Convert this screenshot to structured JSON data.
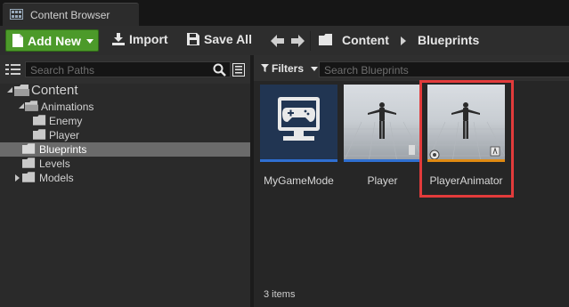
{
  "tab": {
    "title": "Content Browser",
    "icon": "content-browser-icon"
  },
  "toolbar": {
    "add_new_label": "Add New",
    "import_label": "Import",
    "save_all_label": "Save All",
    "breadcrumb": [
      "Content",
      "Blueprints"
    ]
  },
  "left": {
    "search_placeholder": "Search Paths",
    "tree": [
      {
        "label": "Content",
        "expander": "open"
      },
      {
        "label": "Animations",
        "expander": "open"
      },
      {
        "label": "Enemy",
        "expander": ""
      },
      {
        "label": "Player",
        "expander": ""
      },
      {
        "label": "Blueprints",
        "expander": "",
        "selected": true
      },
      {
        "label": "Levels",
        "expander": ""
      },
      {
        "label": "Models",
        "expander": "closed"
      }
    ]
  },
  "right": {
    "filters_label": "Filters",
    "search_placeholder": "Search Blueprints",
    "assets": [
      {
        "name": "MyGameMode",
        "kind": "game-mode",
        "bar_color": "#2f6fd1"
      },
      {
        "name": "Player",
        "kind": "character",
        "bar_color": "#2f6fd1"
      },
      {
        "name": "PlayerAnimator",
        "kind": "anim-blueprint",
        "bar_color": "#e08a12",
        "highlighted": true
      }
    ],
    "status": "3 items"
  },
  "colors": {
    "accent_green": "#4c9a2a",
    "selection": "#6b6b6b",
    "highlight_red": "#e23b3b"
  }
}
